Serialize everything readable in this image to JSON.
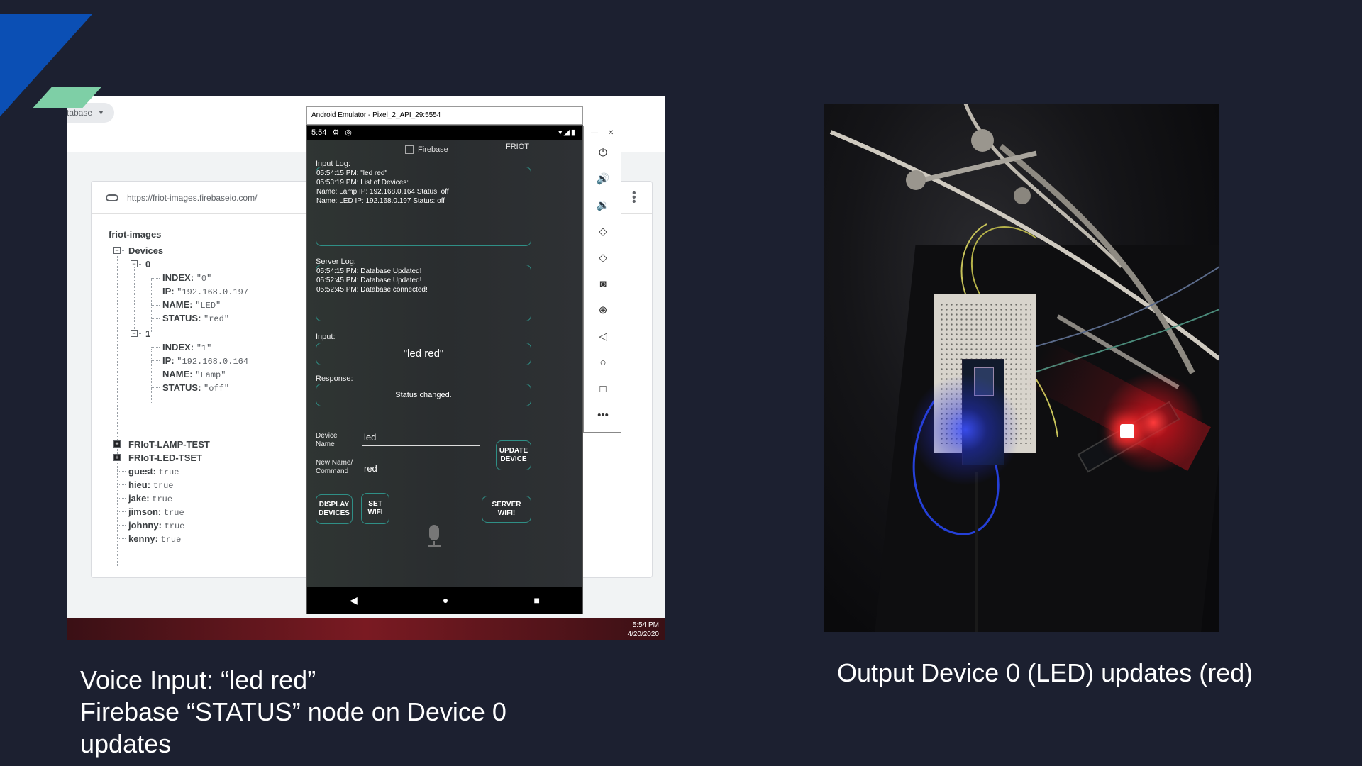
{
  "firebase_console": {
    "db_selector": "tabase",
    "url": "https://friot-images.firebaseio.com/",
    "tree": {
      "root": "friot-images",
      "devices_key": "Devices",
      "device0": {
        "key": "0",
        "index": "\"0\"",
        "ip": "\"192.168.0.197",
        "name": "\"LED\"",
        "status": "\"red\""
      },
      "device1": {
        "key": "1",
        "index": "\"1\"",
        "ip": "\"192.168.0.164",
        "name": "\"Lamp\"",
        "status": "\"off\""
      },
      "field_labels": {
        "index": "INDEX:",
        "ip": "IP:",
        "name": "NAME:",
        "status": "STATUS:"
      },
      "collapsed": [
        "FRIoT-LAMP-TEST",
        "FRIoT-LED-TSET"
      ],
      "users": [
        {
          "key": "guest:",
          "value": "true"
        },
        {
          "key": "hieu:",
          "value": "true"
        },
        {
          "key": "jake:",
          "value": "true"
        },
        {
          "key": "jimson:",
          "value": "true"
        },
        {
          "key": "johnny:",
          "value": "true"
        },
        {
          "key": "kenny:",
          "value": "true"
        }
      ]
    }
  },
  "emulator": {
    "window_title": "Android Emulator - Pixel_2_API_29:5554",
    "clock": "5:54",
    "firebase_checkbox": "Firebase",
    "app_title": "FRIOT",
    "input_log_label": "Input Log:",
    "input_log": [
      "05:54:15 PM: \"led red\"",
      "05:53:19 PM: List of Devices:",
      "Name: Lamp  IP: 192.168.0.164  Status: off",
      "Name: LED  IP: 192.168.0.197  Status: off"
    ],
    "server_log_label": "Server Log:",
    "server_log": [
      "05:54:15 PM: Database Updated!",
      "05:52:45 PM: Database Updated!",
      "05:52:45 PM: Database connected!"
    ],
    "input_label": "Input:",
    "input_value": "\"led red\"",
    "response_label": "Response:",
    "response_value": "Status changed.",
    "device_name_label": "Device Name",
    "device_name_value": "led",
    "command_label": "New Name/ Command",
    "command_value": "red",
    "update_button": "UPDATE DEVICE",
    "display_button": "DISPLAY DEVICES",
    "set_wifi_button": "SET WIFI",
    "server_wifi_button": "SERVER WIFI!"
  },
  "taskbar": {
    "time": "5:54 PM",
    "date": "4/20/2020"
  },
  "captions": {
    "left_line1": "Voice Input: “led red”",
    "left_line2": "Firebase “STATUS” node on Device 0",
    "left_line3": "updates",
    "right": "Output Device 0 (LED) updates (red)"
  },
  "colors": {
    "slide_background": "#1c2030",
    "accent_teal": "#2f8f86",
    "led_red": "#ff3030",
    "mcu_blue": "#3c50ff"
  }
}
